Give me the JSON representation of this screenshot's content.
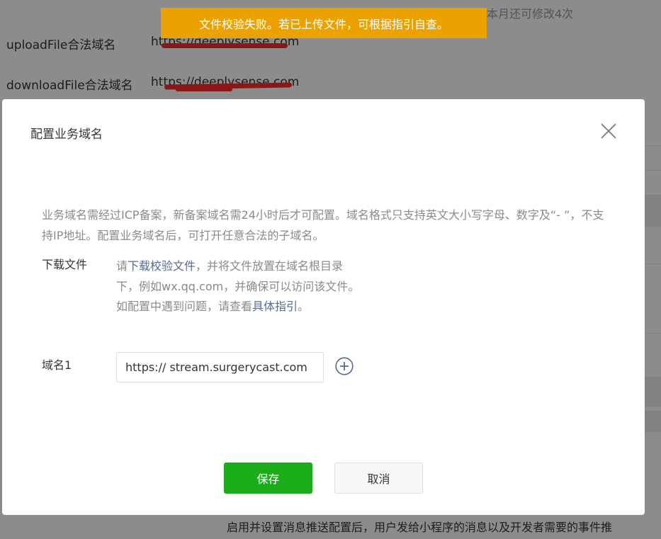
{
  "background": {
    "rows": [
      {
        "label": "uploadFile合法域名",
        "value": "https://deeplysense.com"
      },
      {
        "label": "downloadFile合法域名",
        "value": "https://deeplysense.com"
      }
    ],
    "top_right_text": "本月还可修改4次",
    "footer_text": "启用并设置消息推送配置后，用户发给小程序的消息以及开发者需要的事件推"
  },
  "toast": {
    "message": "文件校验失败。若已上传文件，可根据指引自查。",
    "color": "#eba200"
  },
  "dialog": {
    "title": "配置业务域名",
    "notice": "业务域名需经过ICP备案，新备案域名需24小时后才可配置。域名格式只支持英文大小写字母、数字及“- ”，不支持IP地址。配置业务域名后，可打开任意合法的子域名。",
    "download": {
      "label": "下载文件",
      "desc_prefix": "请",
      "desc_link1": "下载校验文件",
      "desc_middle": "，并将文件放置在域名根目录下，例如wx.qq.com，并确保可以访问该文件。如配置中遇到问题，请查看",
      "desc_link2": "具体指引",
      "desc_suffix": "。"
    },
    "domain": {
      "label": "域名1",
      "value": "https:// stream.surgerycast.com"
    },
    "buttons": {
      "save": "保存",
      "cancel": "取消"
    },
    "colors": {
      "primary": "#1aad19",
      "link": "#576b95"
    },
    "icons": {
      "close": "close-icon",
      "add": "plus-circle-icon"
    }
  }
}
